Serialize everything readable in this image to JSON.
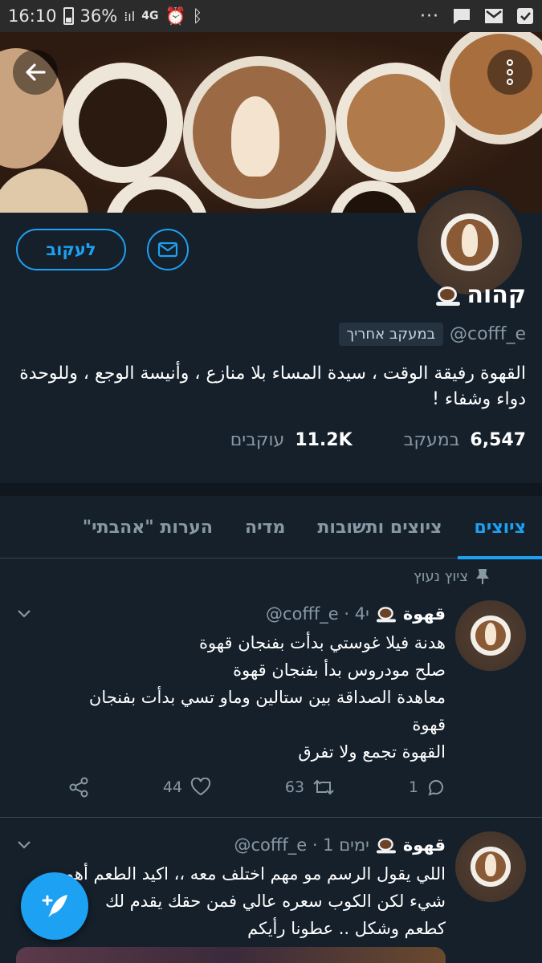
{
  "status_bar": {
    "time": "16:10",
    "battery": "36%",
    "network": "4G",
    "more": "···"
  },
  "profile": {
    "follow_label": "לעקוב",
    "name": "קהוה",
    "handle": "@cofff_e",
    "follows_you": "במעקב אחריך",
    "bio": "القهوة رفيقة الوقت ، سيدة المساء بلا منازع ، وأنيسة الوجع ، وللوحدة دواء وشفاء !",
    "following_count": "6,547",
    "following_label": "במעקב",
    "followers_count": "11.2K",
    "followers_label": "עוקבים"
  },
  "tabs": [
    {
      "label": "ציוצים",
      "active": true
    },
    {
      "label": "ציוצים ותשובות",
      "active": false
    },
    {
      "label": "מדיה",
      "active": false
    },
    {
      "label": "הערות \"אהבתי\"",
      "active": false
    }
  ],
  "pinned_label": "ציוץ נעוץ",
  "tweets": [
    {
      "name": "قهوة",
      "meta": "@cofff_e · 4י",
      "lines": [
        "هدنة فيلا غوستي بدأت بفنجان قهوة",
        "صلح مودروس بدأ بفنجان قهوة",
        "معاهدة الصداقة بين ستالين وماو تسي بدأت بفنجان",
        "قهوة",
        "القهوة تجمع ولا تفرق"
      ],
      "replies": "1",
      "retweets": "63",
      "likes": "44"
    },
    {
      "name": "قهوة",
      "meta": "@cofff_e · 1 ימים",
      "lines": [
        "اللي يقول الرسم مو مهم اختلف معه ،، اكيد الطعم أهم",
        "شيء لكن الكوب سعره عالي فمن حقك يقدم لك",
        "كطعم وشكل .. عطونا رأيكم"
      ]
    }
  ],
  "colors": {
    "background": "#15202b",
    "accent": "#1da1f2",
    "secondary_text": "#8899a6",
    "divider": "#38444d"
  },
  "icons": [
    "back-arrow-icon",
    "more-vertical-icon",
    "mail-icon",
    "pin-icon",
    "chevron-down-icon",
    "reply-icon",
    "retweet-icon",
    "like-icon",
    "share-icon",
    "compose-icon"
  ]
}
